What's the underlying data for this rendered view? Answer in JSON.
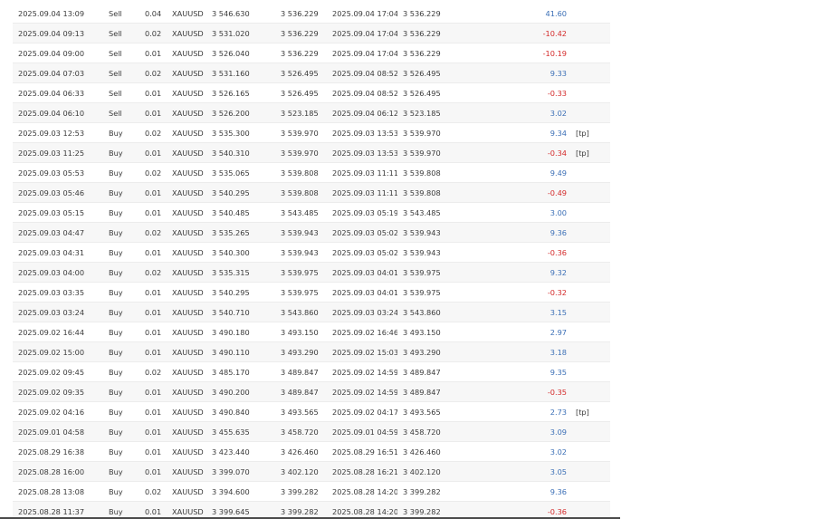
{
  "trades": [
    {
      "open_time": "2025.09.04 13:09",
      "type": "Sell",
      "volume": "0.04",
      "symbol": "XAUUSD",
      "open_price": "3 546.630",
      "close_price": "3 536.229",
      "close_time": "2025.09.04 17:04",
      "price": "3 536.229",
      "profit": "41.60",
      "comment": ""
    },
    {
      "open_time": "2025.09.04 09:13",
      "type": "Sell",
      "volume": "0.02",
      "symbol": "XAUUSD",
      "open_price": "3 531.020",
      "close_price": "3 536.229",
      "close_time": "2025.09.04 17:04",
      "price": "3 536.229",
      "profit": "-10.42",
      "comment": ""
    },
    {
      "open_time": "2025.09.04 09:00",
      "type": "Sell",
      "volume": "0.01",
      "symbol": "XAUUSD",
      "open_price": "3 526.040",
      "close_price": "3 536.229",
      "close_time": "2025.09.04 17:04",
      "price": "3 536.229",
      "profit": "-10.19",
      "comment": ""
    },
    {
      "open_time": "2025.09.04 07:03",
      "type": "Sell",
      "volume": "0.02",
      "symbol": "XAUUSD",
      "open_price": "3 531.160",
      "close_price": "3 526.495",
      "close_time": "2025.09.04 08:52",
      "price": "3 526.495",
      "profit": "9.33",
      "comment": ""
    },
    {
      "open_time": "2025.09.04 06:33",
      "type": "Sell",
      "volume": "0.01",
      "symbol": "XAUUSD",
      "open_price": "3 526.165",
      "close_price": "3 526.495",
      "close_time": "2025.09.04 08:52",
      "price": "3 526.495",
      "profit": "-0.33",
      "comment": ""
    },
    {
      "open_time": "2025.09.04 06:10",
      "type": "Sell",
      "volume": "0.01",
      "symbol": "XAUUSD",
      "open_price": "3 526.200",
      "close_price": "3 523.185",
      "close_time": "2025.09.04 06:12",
      "price": "3 523.185",
      "profit": "3.02",
      "comment": ""
    },
    {
      "open_time": "2025.09.03 12:53",
      "type": "Buy",
      "volume": "0.02",
      "symbol": "XAUUSD",
      "open_price": "3 535.300",
      "close_price": "3 539.970",
      "close_time": "2025.09.03 13:53",
      "price": "3 539.970",
      "profit": "9.34",
      "comment": "[tp]"
    },
    {
      "open_time": "2025.09.03 11:25",
      "type": "Buy",
      "volume": "0.01",
      "symbol": "XAUUSD",
      "open_price": "3 540.310",
      "close_price": "3 539.970",
      "close_time": "2025.09.03 13:53",
      "price": "3 539.970",
      "profit": "-0.34",
      "comment": "[tp]"
    },
    {
      "open_time": "2025.09.03 05:53",
      "type": "Buy",
      "volume": "0.02",
      "symbol": "XAUUSD",
      "open_price": "3 535.065",
      "close_price": "3 539.808",
      "close_time": "2025.09.03 11:11",
      "price": "3 539.808",
      "profit": "9.49",
      "comment": ""
    },
    {
      "open_time": "2025.09.03 05:46",
      "type": "Buy",
      "volume": "0.01",
      "symbol": "XAUUSD",
      "open_price": "3 540.295",
      "close_price": "3 539.808",
      "close_time": "2025.09.03 11:11",
      "price": "3 539.808",
      "profit": "-0.49",
      "comment": ""
    },
    {
      "open_time": "2025.09.03 05:15",
      "type": "Buy",
      "volume": "0.01",
      "symbol": "XAUUSD",
      "open_price": "3 540.485",
      "close_price": "3 543.485",
      "close_time": "2025.09.03 05:19",
      "price": "3 543.485",
      "profit": "3.00",
      "comment": ""
    },
    {
      "open_time": "2025.09.03 04:47",
      "type": "Buy",
      "volume": "0.02",
      "symbol": "XAUUSD",
      "open_price": "3 535.265",
      "close_price": "3 539.943",
      "close_time": "2025.09.03 05:02",
      "price": "3 539.943",
      "profit": "9.36",
      "comment": ""
    },
    {
      "open_time": "2025.09.03 04:31",
      "type": "Buy",
      "volume": "0.01",
      "symbol": "XAUUSD",
      "open_price": "3 540.300",
      "close_price": "3 539.943",
      "close_time": "2025.09.03 05:02",
      "price": "3 539.943",
      "profit": "-0.36",
      "comment": ""
    },
    {
      "open_time": "2025.09.03 04:00",
      "type": "Buy",
      "volume": "0.02",
      "symbol": "XAUUSD",
      "open_price": "3 535.315",
      "close_price": "3 539.975",
      "close_time": "2025.09.03 04:01",
      "price": "3 539.975",
      "profit": "9.32",
      "comment": ""
    },
    {
      "open_time": "2025.09.03 03:35",
      "type": "Buy",
      "volume": "0.01",
      "symbol": "XAUUSD",
      "open_price": "3 540.295",
      "close_price": "3 539.975",
      "close_time": "2025.09.03 04:01",
      "price": "3 539.975",
      "profit": "-0.32",
      "comment": ""
    },
    {
      "open_time": "2025.09.03 03:24",
      "type": "Buy",
      "volume": "0.01",
      "symbol": "XAUUSD",
      "open_price": "3 540.710",
      "close_price": "3 543.860",
      "close_time": "2025.09.03 03:24",
      "price": "3 543.860",
      "profit": "3.15",
      "comment": ""
    },
    {
      "open_time": "2025.09.02 16:44",
      "type": "Buy",
      "volume": "0.01",
      "symbol": "XAUUSD",
      "open_price": "3 490.180",
      "close_price": "3 493.150",
      "close_time": "2025.09.02 16:46",
      "price": "3 493.150",
      "profit": "2.97",
      "comment": ""
    },
    {
      "open_time": "2025.09.02 15:00",
      "type": "Buy",
      "volume": "0.01",
      "symbol": "XAUUSD",
      "open_price": "3 490.110",
      "close_price": "3 493.290",
      "close_time": "2025.09.02 15:03",
      "price": "3 493.290",
      "profit": "3.18",
      "comment": ""
    },
    {
      "open_time": "2025.09.02 09:45",
      "type": "Buy",
      "volume": "0.02",
      "symbol": "XAUUSD",
      "open_price": "3 485.170",
      "close_price": "3 489.847",
      "close_time": "2025.09.02 14:59",
      "price": "3 489.847",
      "profit": "9.35",
      "comment": ""
    },
    {
      "open_time": "2025.09.02 09:35",
      "type": "Buy",
      "volume": "0.01",
      "symbol": "XAUUSD",
      "open_price": "3 490.200",
      "close_price": "3 489.847",
      "close_time": "2025.09.02 14:59",
      "price": "3 489.847",
      "profit": "-0.35",
      "comment": ""
    },
    {
      "open_time": "2025.09.02 04:16",
      "type": "Buy",
      "volume": "0.01",
      "symbol": "XAUUSD",
      "open_price": "3 490.840",
      "close_price": "3 493.565",
      "close_time": "2025.09.02 04:17",
      "price": "3 493.565",
      "profit": "2.73",
      "comment": "[tp]"
    },
    {
      "open_time": "2025.09.01 04:58",
      "type": "Buy",
      "volume": "0.01",
      "symbol": "XAUUSD",
      "open_price": "3 455.635",
      "close_price": "3 458.720",
      "close_time": "2025.09.01 04:59",
      "price": "3 458.720",
      "profit": "3.09",
      "comment": ""
    },
    {
      "open_time": "2025.08.29 16:38",
      "type": "Buy",
      "volume": "0.01",
      "symbol": "XAUUSD",
      "open_price": "3 423.440",
      "close_price": "3 426.460",
      "close_time": "2025.08.29 16:51",
      "price": "3 426.460",
      "profit": "3.02",
      "comment": ""
    },
    {
      "open_time": "2025.08.28 16:00",
      "type": "Buy",
      "volume": "0.01",
      "symbol": "XAUUSD",
      "open_price": "3 399.070",
      "close_price": "3 402.120",
      "close_time": "2025.08.28 16:21",
      "price": "3 402.120",
      "profit": "3.05",
      "comment": ""
    },
    {
      "open_time": "2025.08.28 13:08",
      "type": "Buy",
      "volume": "0.02",
      "symbol": "XAUUSD",
      "open_price": "3 394.600",
      "close_price": "3 399.282",
      "close_time": "2025.08.28 14:20",
      "price": "3 399.282",
      "profit": "9.36",
      "comment": ""
    },
    {
      "open_time": "2025.08.28 11:37",
      "type": "Buy",
      "volume": "0.01",
      "symbol": "XAUUSD",
      "open_price": "3 399.645",
      "close_price": "3 399.282",
      "close_time": "2025.08.28 14:20",
      "price": "3 399.282",
      "profit": "-0.36",
      "comment": ""
    }
  ],
  "colors": {
    "positive_profit": "#3b6fb6",
    "negative_profit": "#d42a2a",
    "row_alt_background": "#f7f7f7",
    "text": "#3a3a3a"
  }
}
